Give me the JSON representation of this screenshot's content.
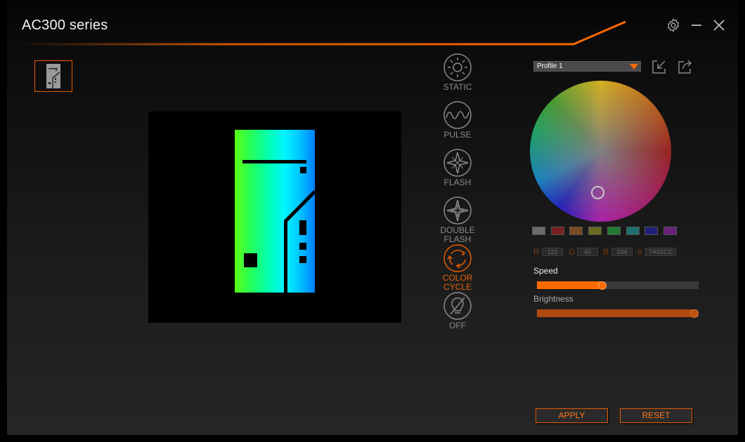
{
  "window": {
    "title": "AC300 series"
  },
  "controls": {
    "settings": "gear-icon",
    "minimize": "minimize-icon",
    "close": "close-icon"
  },
  "device": {
    "icon": "pc-case-icon",
    "selected": true
  },
  "modes": [
    {
      "id": "static",
      "label_lines": [
        "STATIC"
      ],
      "icon": "sun-icon",
      "active": false
    },
    {
      "id": "pulse",
      "label_lines": [
        "PULSE"
      ],
      "icon": "wave-icon",
      "active": false
    },
    {
      "id": "flash",
      "label_lines": [
        "FLASH"
      ],
      "icon": "star-icon",
      "active": false
    },
    {
      "id": "double-flash",
      "label_lines": [
        "DOUBLE",
        "FLASH"
      ],
      "icon": "double-star-icon",
      "active": false
    },
    {
      "id": "color-cycle",
      "label_lines": [
        "COLOR",
        "CYCLE"
      ],
      "icon": "cycle-icon",
      "active": true
    },
    {
      "id": "off",
      "label_lines": [
        "OFF"
      ],
      "icon": "bulb-off-icon",
      "active": false
    }
  ],
  "profile": {
    "selected": "Profile 1",
    "import_icon": "import-icon",
    "export_icon": "export-icon"
  },
  "swatches": [
    "#6b6b6b",
    "#7a2020",
    "#7a4a20",
    "#6a6a20",
    "#207a30",
    "#207070",
    "#20207a",
    "#6a207a"
  ],
  "color": {
    "r_label": "R",
    "r": "122",
    "g_label": "G",
    "g": "40",
    "b_label": "B",
    "b": "204",
    "hex_label": "#",
    "hex": "7A31CC"
  },
  "speed": {
    "label": "Speed",
    "value": 0.4
  },
  "brightness": {
    "label": "Brightness",
    "value": 1.0
  },
  "buttons": {
    "apply": "APPLY",
    "reset": "RESET"
  },
  "colors": {
    "accent": "#e65c00",
    "accent_text": "#ff7a1a"
  }
}
